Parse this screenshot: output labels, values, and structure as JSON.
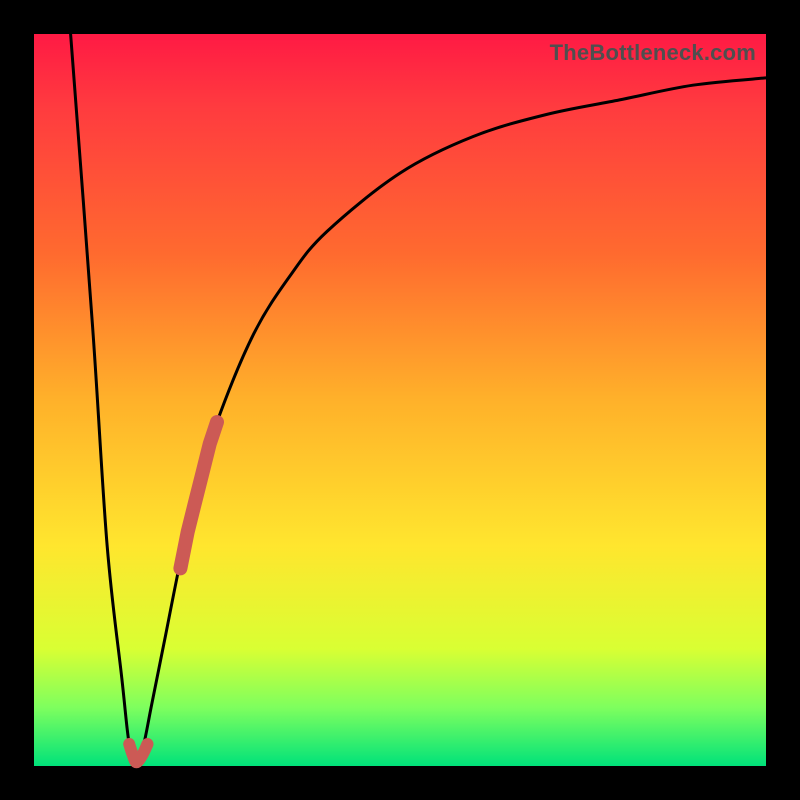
{
  "attribution": "TheBottleneck.com",
  "colors": {
    "curve_stroke": "#000000",
    "marker_stroke": "#cc5a55",
    "gradient_top": "#ff1a44",
    "gradient_bottom": "#00e27a"
  },
  "chart_data": {
    "type": "line",
    "title": "",
    "xlabel": "",
    "ylabel": "",
    "xlim": [
      0,
      100
    ],
    "ylim": [
      0,
      100
    ],
    "series": [
      {
        "name": "curve",
        "x": [
          5,
          8,
          10,
          12,
          13,
          14,
          15,
          16,
          18,
          20,
          22,
          25,
          30,
          35,
          40,
          50,
          60,
          70,
          80,
          90,
          100
        ],
        "values": [
          100,
          60,
          30,
          12,
          3,
          0,
          3,
          8,
          18,
          28,
          37,
          47,
          59,
          67,
          73,
          81,
          86,
          89,
          91,
          93,
          94
        ]
      },
      {
        "name": "marker-segment",
        "x": [
          20,
          21,
          22,
          23,
          24,
          25
        ],
        "values": [
          27,
          32,
          36,
          40,
          44,
          47
        ]
      },
      {
        "name": "marker-hook",
        "x": [
          13.0,
          13.5,
          14.0,
          14.8,
          15.5
        ],
        "values": [
          3.0,
          1.5,
          0.5,
          1.5,
          3.0
        ]
      }
    ]
  }
}
